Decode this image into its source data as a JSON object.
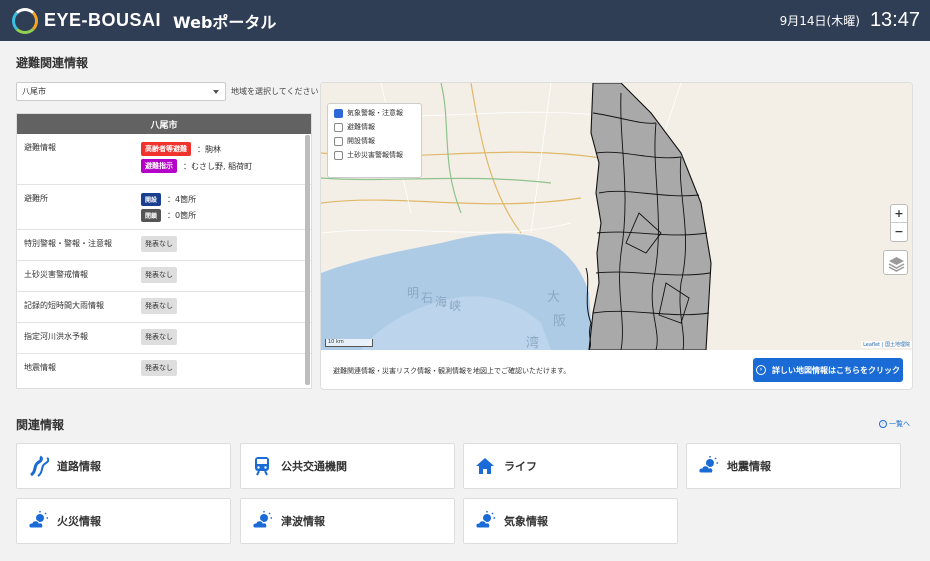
{
  "header": {
    "logo_text": "EYE-BOUSAI",
    "portal": "Webポータル",
    "date": "9月14日(木曜)",
    "time": "13:47"
  },
  "evac": {
    "title": "避難関連情報",
    "region_select": "八尾市",
    "select_hint": "地域を選択してください",
    "panel_title": "八尾市",
    "rows": {
      "evac_info": {
        "label": "避難情報",
        "tag1": "高齢者等避難",
        "value1": "：駒林",
        "tag2": "避難指示",
        "value2": "：むさし野, 稲荷町"
      },
      "shelters": {
        "label": "避難所",
        "open_tag": "開設",
        "open_value": "：4箇所",
        "closed_tag": "閉鎖",
        "closed_value": "：0箇所"
      },
      "warnings": {
        "label": "特別警報・警報・注意報",
        "status": "発表なし"
      },
      "landslide": {
        "label": "土砂災害警戒情報",
        "status": "発表なし"
      },
      "heavy_rain": {
        "label": "記録的短時間大雨情報",
        "status": "発表なし"
      },
      "river_flood": {
        "label": "指定河川洪水予報",
        "status": "発表なし"
      },
      "earthquake": {
        "label": "地震情報",
        "status": "発表なし"
      }
    }
  },
  "map": {
    "layers": [
      {
        "label": "気象警報・注意報",
        "checked": true
      },
      {
        "label": "避難情報",
        "checked": false
      },
      {
        "label": "開設情報",
        "checked": false
      },
      {
        "label": "土砂災害警報情報",
        "checked": false
      }
    ],
    "zoom_in": "+",
    "zoom_out": "−",
    "scale": "10 km",
    "attribution": "Leaflet | 国土地理院",
    "labels": {
      "bay1": "明",
      "bay2": "石",
      "bay3": "海",
      "bay4": "峡",
      "osaka1": "大",
      "osaka2": "阪",
      "osaka3": "湾"
    },
    "note": "避難関連情報・災害リスク情報・観測情報を地図上でご確認いただけます。",
    "detail_button": "詳しい地図情報はこちらをクリック"
  },
  "related": {
    "title": "関連情報",
    "all_link": "一覧へ",
    "items": [
      "道路情報",
      "公共交通機関",
      "ライフ",
      "地震情報",
      "火災情報",
      "津波情報",
      "気象情報"
    ]
  },
  "colors": {
    "header_bg": "#2f3d55",
    "tag_red": "#f0332d",
    "tag_purple": "#b400c8",
    "tag_open": "#1a3f8f",
    "tag_closed": "#555555",
    "accent": "#1a6bd6"
  }
}
